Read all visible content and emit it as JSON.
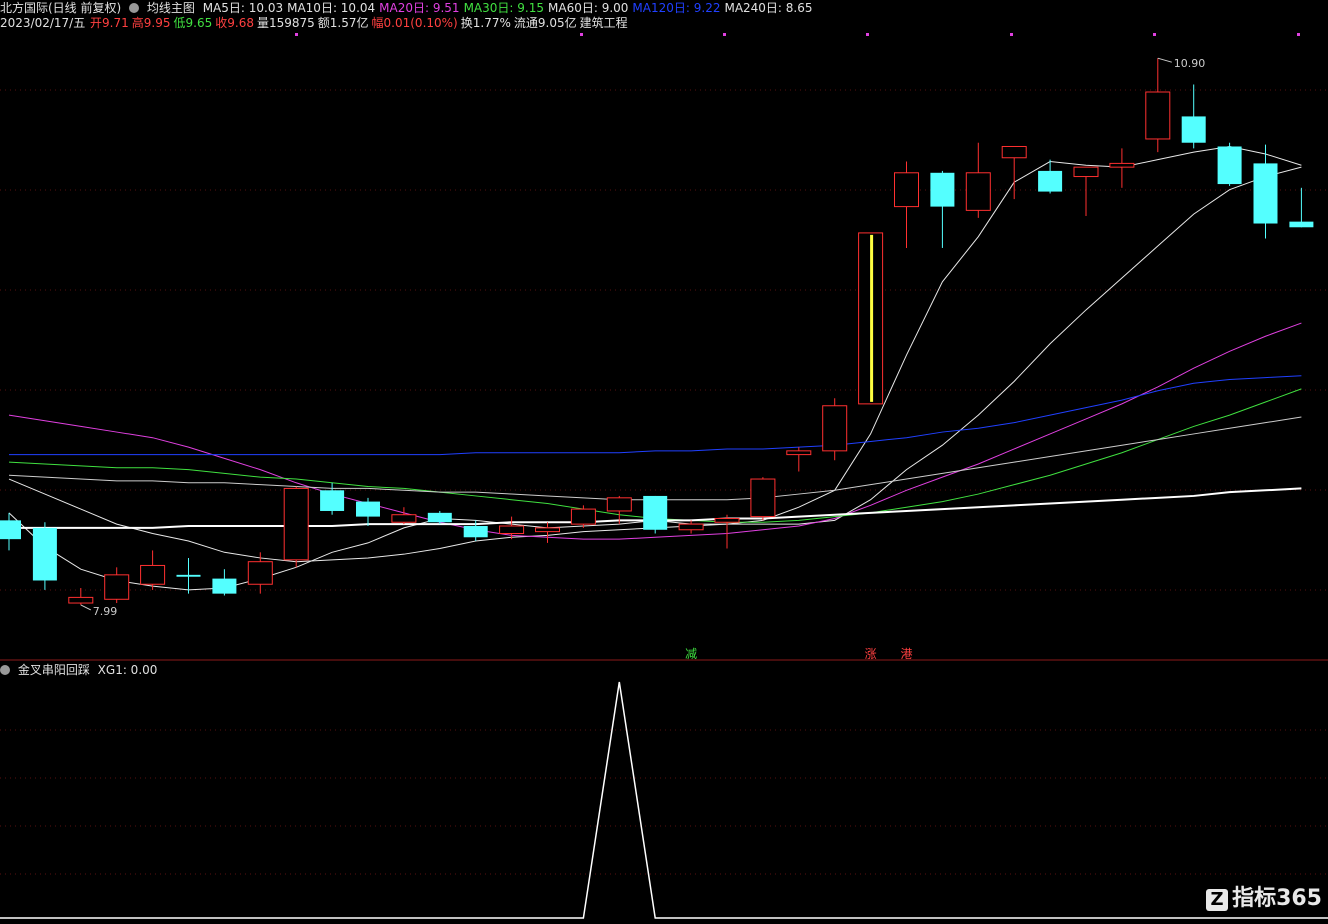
{
  "header": {
    "stock_name": "北方国际(日线 前复权)",
    "indicator_name": "均线主图",
    "ma": [
      {
        "label": "MA5日: 10.03",
        "color": "#e0e0e0"
      },
      {
        "label": "MA10日: 10.04",
        "color": "#e0e0e0"
      },
      {
        "label": "MA20日: 9.51",
        "color": "#e040e0"
      },
      {
        "label": "MA30日: 9.15",
        "color": "#40e040"
      },
      {
        "label": "MA60日: 9.00",
        "color": "#e0e0e0"
      },
      {
        "label": "MA120日: 9.22",
        "color": "#2040ff"
      },
      {
        "label": "MA240日: 8.65",
        "color": "#e0e0e0"
      }
    ],
    "date": "2023/02/17/五",
    "fields": [
      {
        "label": "开9.71",
        "color": "#ff4040"
      },
      {
        "label": "高9.95",
        "color": "#ff4040"
      },
      {
        "label": "低9.65",
        "color": "#40e040"
      },
      {
        "label": "收9.68",
        "color": "#ff4040"
      },
      {
        "label": "量159875",
        "color": "#e0e0e0"
      },
      {
        "label": "额1.57亿",
        "color": "#e0e0e0"
      },
      {
        "label": "幅0.01(0.10%)",
        "color": "#ff4040"
      },
      {
        "label": "换1.77%",
        "color": "#e0e0e0"
      },
      {
        "label": "流通9.05亿",
        "color": "#e0e0e0"
      },
      {
        "label": "建筑工程",
        "color": "#e0e0e0"
      }
    ]
  },
  "sub_header": {
    "indicator_name": "金叉串阳回踩",
    "value": "XG1: 0.00"
  },
  "markers": [
    {
      "text": "减",
      "color": "#40e040"
    },
    {
      "text": "涨",
      "color": "#ff4040"
    },
    {
      "text": "港",
      "color": "#ff4040"
    }
  ],
  "chart_data": [
    {
      "type": "candlestick",
      "ylim": [
        7.75,
        11.05
      ],
      "high_label": "10.90",
      "low_label": "7.99",
      "colors": {
        "up": "#ff3030",
        "down": "#54ffff",
        "limit_up": "#ffff40"
      },
      "candles": [
        {
          "o": 8.44,
          "h": 8.48,
          "l": 8.28,
          "c": 8.34
        },
        {
          "o": 8.4,
          "h": 8.43,
          "l": 8.07,
          "c": 8.12
        },
        {
          "o": 8.0,
          "h": 8.08,
          "l": 7.99,
          "c": 8.03
        },
        {
          "o": 8.02,
          "h": 8.19,
          "l": 8.0,
          "c": 8.15
        },
        {
          "o": 8.1,
          "h": 8.28,
          "l": 8.07,
          "c": 8.2
        },
        {
          "o": 8.15,
          "h": 8.24,
          "l": 8.05,
          "c": 8.14
        },
        {
          "o": 8.13,
          "h": 8.18,
          "l": 8.04,
          "c": 8.05
        },
        {
          "o": 8.1,
          "h": 8.27,
          "l": 8.05,
          "c": 8.22
        },
        {
          "o": 8.23,
          "h": 8.62,
          "l": 8.19,
          "c": 8.61
        },
        {
          "o": 8.6,
          "h": 8.64,
          "l": 8.47,
          "c": 8.49
        },
        {
          "o": 8.54,
          "h": 8.56,
          "l": 8.41,
          "c": 8.46
        },
        {
          "o": 8.43,
          "h": 8.51,
          "l": 8.42,
          "c": 8.47
        },
        {
          "o": 8.48,
          "h": 8.49,
          "l": 8.42,
          "c": 8.43
        },
        {
          "o": 8.41,
          "h": 8.44,
          "l": 8.33,
          "c": 8.35
        },
        {
          "o": 8.37,
          "h": 8.46,
          "l": 8.34,
          "c": 8.41
        },
        {
          "o": 8.38,
          "h": 8.43,
          "l": 8.32,
          "c": 8.4
        },
        {
          "o": 8.42,
          "h": 8.52,
          "l": 8.4,
          "c": 8.5
        },
        {
          "o": 8.49,
          "h": 8.57,
          "l": 8.42,
          "c": 8.56
        },
        {
          "o": 8.57,
          "h": 8.57,
          "l": 8.37,
          "c": 8.39
        },
        {
          "o": 8.39,
          "h": 8.44,
          "l": 8.37,
          "c": 8.42
        },
        {
          "o": 8.43,
          "h": 8.47,
          "l": 8.29,
          "c": 8.45
        },
        {
          "o": 8.46,
          "h": 8.67,
          "l": 8.44,
          "c": 8.66
        },
        {
          "o": 8.79,
          "h": 8.83,
          "l": 8.7,
          "c": 8.81
        },
        {
          "o": 8.81,
          "h": 9.09,
          "l": 8.76,
          "c": 9.05
        },
        {
          "o": 9.06,
          "h": 9.97,
          "l": 9.06,
          "c": 9.97
        },
        {
          "o": 10.11,
          "h": 10.35,
          "l": 9.89,
          "c": 10.29
        },
        {
          "o": 10.29,
          "h": 10.3,
          "l": 9.89,
          "c": 10.11
        },
        {
          "o": 10.09,
          "h": 10.45,
          "l": 10.05,
          "c": 10.29
        },
        {
          "o": 10.37,
          "h": 10.42,
          "l": 10.15,
          "c": 10.43
        },
        {
          "o": 10.3,
          "h": 10.36,
          "l": 10.18,
          "c": 10.19
        },
        {
          "o": 10.27,
          "h": 10.31,
          "l": 10.06,
          "c": 10.32
        },
        {
          "o": 10.32,
          "h": 10.42,
          "l": 10.21,
          "c": 10.34
        },
        {
          "o": 10.47,
          "h": 10.9,
          "l": 10.4,
          "c": 10.72
        },
        {
          "o": 10.59,
          "h": 10.76,
          "l": 10.42,
          "c": 10.45
        },
        {
          "o": 10.43,
          "h": 10.45,
          "l": 10.22,
          "c": 10.23
        },
        {
          "o": 10.34,
          "h": 10.44,
          "l": 9.94,
          "c": 10.02
        },
        {
          "o": 10.03,
          "h": 10.21,
          "l": 10.0,
          "c": 10.0
        }
      ],
      "ma_lines": [
        {
          "name": "MA5",
          "color": "#e8e8e8",
          "values": [
            8.48,
            8.3,
            8.18,
            8.12,
            8.09,
            8.07,
            8.08,
            8.13,
            8.19,
            8.27,
            8.32,
            8.4,
            8.45,
            8.44,
            8.42,
            8.4,
            8.41,
            8.42,
            8.44,
            8.42,
            8.42,
            8.44,
            8.51,
            8.6,
            8.9,
            9.32,
            9.71,
            9.95,
            10.24,
            10.35,
            10.33,
            10.32,
            10.36,
            10.4,
            10.43,
            10.39,
            10.33
          ]
        },
        {
          "name": "MA10",
          "color": "#e8e8e8",
          "values": [
            8.66,
            8.58,
            8.5,
            8.42,
            8.37,
            8.33,
            8.27,
            8.24,
            8.22,
            8.23,
            8.24,
            8.26,
            8.29,
            8.33,
            8.35,
            8.36,
            8.38,
            8.39,
            8.4,
            8.41,
            8.42,
            8.42,
            8.42,
            8.44,
            8.55,
            8.71,
            8.84,
            9.0,
            9.18,
            9.38,
            9.56,
            9.73,
            9.9,
            10.07,
            10.2,
            10.27,
            10.32
          ]
        },
        {
          "name": "MA20",
          "color": "#e040e0",
          "values": [
            9.0,
            8.97,
            8.94,
            8.91,
            8.88,
            8.83,
            8.77,
            8.71,
            8.64,
            8.58,
            8.53,
            8.48,
            8.43,
            8.39,
            8.36,
            8.35,
            8.34,
            8.34,
            8.35,
            8.36,
            8.37,
            8.39,
            8.41,
            8.45,
            8.52,
            8.6,
            8.67,
            8.74,
            8.82,
            8.9,
            8.98,
            9.06,
            9.15,
            9.25,
            9.34,
            9.42,
            9.49
          ]
        },
        {
          "name": "MA30",
          "color": "#40e040",
          "values": [
            8.75,
            8.74,
            8.73,
            8.72,
            8.72,
            8.71,
            8.69,
            8.67,
            8.66,
            8.64,
            8.62,
            8.61,
            8.59,
            8.57,
            8.55,
            8.53,
            8.5,
            8.47,
            8.45,
            8.44,
            8.43,
            8.43,
            8.44,
            8.46,
            8.48,
            8.51,
            8.54,
            8.58,
            8.63,
            8.68,
            8.74,
            8.8,
            8.87,
            8.94,
            9.0,
            9.07,
            9.14
          ]
        },
        {
          "name": "MA60",
          "color": "#cccccc",
          "values": [
            8.68,
            8.67,
            8.66,
            8.65,
            8.65,
            8.64,
            8.64,
            8.63,
            8.62,
            8.61,
            8.61,
            8.6,
            8.59,
            8.59,
            8.58,
            8.57,
            8.56,
            8.55,
            8.55,
            8.55,
            8.55,
            8.56,
            8.58,
            8.6,
            8.63,
            8.66,
            8.69,
            8.72,
            8.75,
            8.78,
            8.81,
            8.84,
            8.87,
            8.9,
            8.93,
            8.96,
            8.99
          ]
        },
        {
          "name": "MA120",
          "color": "#2040ff",
          "values": [
            8.79,
            8.79,
            8.79,
            8.79,
            8.79,
            8.79,
            8.79,
            8.79,
            8.79,
            8.79,
            8.79,
            8.79,
            8.79,
            8.8,
            8.8,
            8.8,
            8.8,
            8.8,
            8.81,
            8.81,
            8.82,
            8.82,
            8.83,
            8.84,
            8.86,
            8.88,
            8.91,
            8.93,
            8.96,
            9.0,
            9.04,
            9.08,
            9.13,
            9.17,
            9.19,
            9.2,
            9.21
          ]
        },
        {
          "name": "MA240",
          "color": "#ffffff",
          "values": [
            8.4,
            8.4,
            8.4,
            8.4,
            8.4,
            8.41,
            8.41,
            8.41,
            8.41,
            8.41,
            8.42,
            8.42,
            8.42,
            8.42,
            8.43,
            8.43,
            8.43,
            8.44,
            8.44,
            8.44,
            8.45,
            8.45,
            8.46,
            8.47,
            8.48,
            8.49,
            8.5,
            8.51,
            8.52,
            8.53,
            8.54,
            8.55,
            8.56,
            8.57,
            8.59,
            8.6,
            8.61
          ]
        }
      ]
    },
    {
      "type": "line",
      "series": [
        {
          "values": [
            0,
            0,
            0,
            0,
            0,
            0,
            0,
            0,
            0,
            0,
            0,
            0,
            0,
            0,
            0,
            0,
            0,
            1,
            0,
            0,
            0,
            0,
            0,
            0,
            0,
            0,
            0,
            0,
            0,
            0,
            0,
            0,
            0,
            0,
            0,
            0,
            0
          ]
        }
      ],
      "ylim": [
        0,
        1
      ]
    }
  ],
  "watermark": "指标365"
}
